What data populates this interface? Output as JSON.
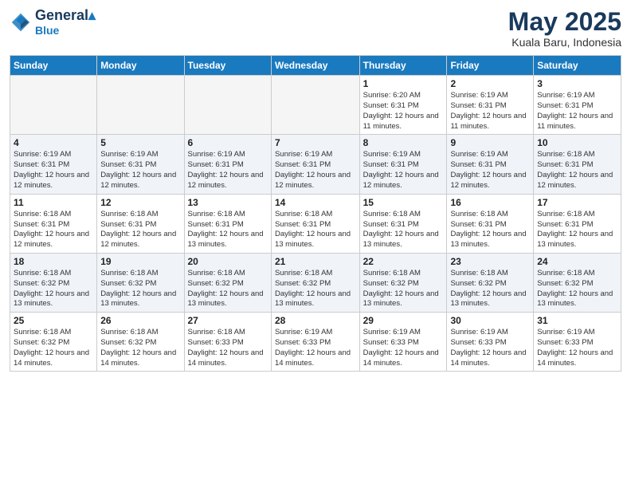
{
  "header": {
    "logo_line1": "General",
    "logo_line2": "Blue",
    "month": "May 2025",
    "location": "Kuala Baru, Indonesia"
  },
  "days_of_week": [
    "Sunday",
    "Monday",
    "Tuesday",
    "Wednesday",
    "Thursday",
    "Friday",
    "Saturday"
  ],
  "weeks": [
    [
      {
        "day": "",
        "sunrise": "",
        "sunset": "",
        "daylight": "",
        "empty": true
      },
      {
        "day": "",
        "sunrise": "",
        "sunset": "",
        "daylight": "",
        "empty": true
      },
      {
        "day": "",
        "sunrise": "",
        "sunset": "",
        "daylight": "",
        "empty": true
      },
      {
        "day": "",
        "sunrise": "",
        "sunset": "",
        "daylight": "",
        "empty": true
      },
      {
        "day": "1",
        "sunrise": "Sunrise: 6:20 AM",
        "sunset": "Sunset: 6:31 PM",
        "daylight": "Daylight: 12 hours and 11 minutes.",
        "empty": false
      },
      {
        "day": "2",
        "sunrise": "Sunrise: 6:19 AM",
        "sunset": "Sunset: 6:31 PM",
        "daylight": "Daylight: 12 hours and 11 minutes.",
        "empty": false
      },
      {
        "day": "3",
        "sunrise": "Sunrise: 6:19 AM",
        "sunset": "Sunset: 6:31 PM",
        "daylight": "Daylight: 12 hours and 11 minutes.",
        "empty": false
      }
    ],
    [
      {
        "day": "4",
        "sunrise": "Sunrise: 6:19 AM",
        "sunset": "Sunset: 6:31 PM",
        "daylight": "Daylight: 12 hours and 12 minutes.",
        "empty": false
      },
      {
        "day": "5",
        "sunrise": "Sunrise: 6:19 AM",
        "sunset": "Sunset: 6:31 PM",
        "daylight": "Daylight: 12 hours and 12 minutes.",
        "empty": false
      },
      {
        "day": "6",
        "sunrise": "Sunrise: 6:19 AM",
        "sunset": "Sunset: 6:31 PM",
        "daylight": "Daylight: 12 hours and 12 minutes.",
        "empty": false
      },
      {
        "day": "7",
        "sunrise": "Sunrise: 6:19 AM",
        "sunset": "Sunset: 6:31 PM",
        "daylight": "Daylight: 12 hours and 12 minutes.",
        "empty": false
      },
      {
        "day": "8",
        "sunrise": "Sunrise: 6:19 AM",
        "sunset": "Sunset: 6:31 PM",
        "daylight": "Daylight: 12 hours and 12 minutes.",
        "empty": false
      },
      {
        "day": "9",
        "sunrise": "Sunrise: 6:19 AM",
        "sunset": "Sunset: 6:31 PM",
        "daylight": "Daylight: 12 hours and 12 minutes.",
        "empty": false
      },
      {
        "day": "10",
        "sunrise": "Sunrise: 6:18 AM",
        "sunset": "Sunset: 6:31 PM",
        "daylight": "Daylight: 12 hours and 12 minutes.",
        "empty": false
      }
    ],
    [
      {
        "day": "11",
        "sunrise": "Sunrise: 6:18 AM",
        "sunset": "Sunset: 6:31 PM",
        "daylight": "Daylight: 12 hours and 12 minutes.",
        "empty": false
      },
      {
        "day": "12",
        "sunrise": "Sunrise: 6:18 AM",
        "sunset": "Sunset: 6:31 PM",
        "daylight": "Daylight: 12 hours and 12 minutes.",
        "empty": false
      },
      {
        "day": "13",
        "sunrise": "Sunrise: 6:18 AM",
        "sunset": "Sunset: 6:31 PM",
        "daylight": "Daylight: 12 hours and 13 minutes.",
        "empty": false
      },
      {
        "day": "14",
        "sunrise": "Sunrise: 6:18 AM",
        "sunset": "Sunset: 6:31 PM",
        "daylight": "Daylight: 12 hours and 13 minutes.",
        "empty": false
      },
      {
        "day": "15",
        "sunrise": "Sunrise: 6:18 AM",
        "sunset": "Sunset: 6:31 PM",
        "daylight": "Daylight: 12 hours and 13 minutes.",
        "empty": false
      },
      {
        "day": "16",
        "sunrise": "Sunrise: 6:18 AM",
        "sunset": "Sunset: 6:31 PM",
        "daylight": "Daylight: 12 hours and 13 minutes.",
        "empty": false
      },
      {
        "day": "17",
        "sunrise": "Sunrise: 6:18 AM",
        "sunset": "Sunset: 6:31 PM",
        "daylight": "Daylight: 12 hours and 13 minutes.",
        "empty": false
      }
    ],
    [
      {
        "day": "18",
        "sunrise": "Sunrise: 6:18 AM",
        "sunset": "Sunset: 6:32 PM",
        "daylight": "Daylight: 12 hours and 13 minutes.",
        "empty": false
      },
      {
        "day": "19",
        "sunrise": "Sunrise: 6:18 AM",
        "sunset": "Sunset: 6:32 PM",
        "daylight": "Daylight: 12 hours and 13 minutes.",
        "empty": false
      },
      {
        "day": "20",
        "sunrise": "Sunrise: 6:18 AM",
        "sunset": "Sunset: 6:32 PM",
        "daylight": "Daylight: 12 hours and 13 minutes.",
        "empty": false
      },
      {
        "day": "21",
        "sunrise": "Sunrise: 6:18 AM",
        "sunset": "Sunset: 6:32 PM",
        "daylight": "Daylight: 12 hours and 13 minutes.",
        "empty": false
      },
      {
        "day": "22",
        "sunrise": "Sunrise: 6:18 AM",
        "sunset": "Sunset: 6:32 PM",
        "daylight": "Daylight: 12 hours and 13 minutes.",
        "empty": false
      },
      {
        "day": "23",
        "sunrise": "Sunrise: 6:18 AM",
        "sunset": "Sunset: 6:32 PM",
        "daylight": "Daylight: 12 hours and 13 minutes.",
        "empty": false
      },
      {
        "day": "24",
        "sunrise": "Sunrise: 6:18 AM",
        "sunset": "Sunset: 6:32 PM",
        "daylight": "Daylight: 12 hours and 13 minutes.",
        "empty": false
      }
    ],
    [
      {
        "day": "25",
        "sunrise": "Sunrise: 6:18 AM",
        "sunset": "Sunset: 6:32 PM",
        "daylight": "Daylight: 12 hours and 14 minutes.",
        "empty": false
      },
      {
        "day": "26",
        "sunrise": "Sunrise: 6:18 AM",
        "sunset": "Sunset: 6:32 PM",
        "daylight": "Daylight: 12 hours and 14 minutes.",
        "empty": false
      },
      {
        "day": "27",
        "sunrise": "Sunrise: 6:18 AM",
        "sunset": "Sunset: 6:33 PM",
        "daylight": "Daylight: 12 hours and 14 minutes.",
        "empty": false
      },
      {
        "day": "28",
        "sunrise": "Sunrise: 6:19 AM",
        "sunset": "Sunset: 6:33 PM",
        "daylight": "Daylight: 12 hours and 14 minutes.",
        "empty": false
      },
      {
        "day": "29",
        "sunrise": "Sunrise: 6:19 AM",
        "sunset": "Sunset: 6:33 PM",
        "daylight": "Daylight: 12 hours and 14 minutes.",
        "empty": false
      },
      {
        "day": "30",
        "sunrise": "Sunrise: 6:19 AM",
        "sunset": "Sunset: 6:33 PM",
        "daylight": "Daylight: 12 hours and 14 minutes.",
        "empty": false
      },
      {
        "day": "31",
        "sunrise": "Sunrise: 6:19 AM",
        "sunset": "Sunset: 6:33 PM",
        "daylight": "Daylight: 12 hours and 14 minutes.",
        "empty": false
      }
    ]
  ]
}
